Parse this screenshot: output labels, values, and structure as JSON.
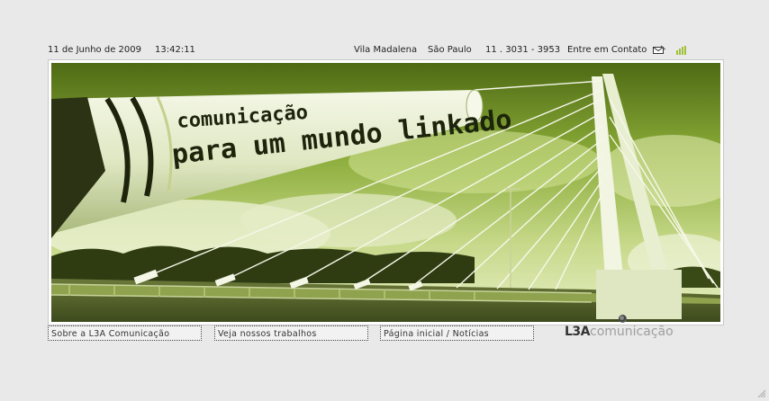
{
  "header": {
    "date": "11 de Junho de 2009",
    "time": "13:42:11",
    "neighborhood": "Vila Madalena",
    "city": "São Paulo",
    "phone": "11 . 3031 - 3953",
    "contact_label": "Entre em Contato",
    "contact_icon": "mail-icon",
    "status_icon": "signal-bars-icon"
  },
  "hero": {
    "graffiti_line1": "comunicação",
    "graffiti_line2": "para um mundo linkado",
    "tint_color": "#8fb23a"
  },
  "nav": {
    "about": "Sobre a L3A Comunicação",
    "works": "Veja nossos trabalhos",
    "home": "Página inicial / Notícias"
  },
  "brand": {
    "logo_part1": "L3A",
    "logo_part2": "comunicação",
    "accent": "#9fc23a"
  }
}
